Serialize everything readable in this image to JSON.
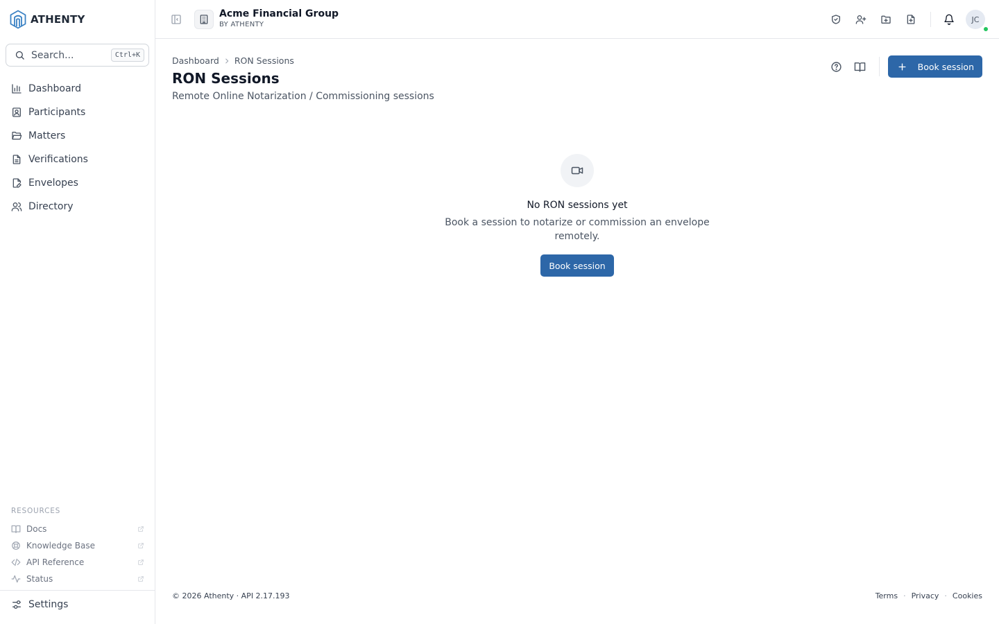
{
  "brand": {
    "name": "ATHENTY",
    "logo_icon": "athenty-logo-icon",
    "accent": "#2d67a8"
  },
  "search": {
    "placeholder": "Search...",
    "shortcut": "Ctrl+K"
  },
  "sidebar": {
    "items": [
      {
        "label": "Dashboard",
        "icon": "bar-chart-icon"
      },
      {
        "label": "Participants",
        "icon": "id-badge-icon"
      },
      {
        "label": "Matters",
        "icon": "folder-open-icon"
      },
      {
        "label": "Verifications",
        "icon": "file-text-icon"
      },
      {
        "label": "Envelopes",
        "icon": "file-signature-icon"
      },
      {
        "label": "Directory",
        "icon": "users-icon"
      }
    ],
    "resources_label": "RESOURCES",
    "resources": [
      {
        "label": "Docs",
        "icon": "book-open-icon"
      },
      {
        "label": "Knowledge Base",
        "icon": "life-buoy-icon"
      },
      {
        "label": "API Reference",
        "icon": "code-icon"
      },
      {
        "label": "Status",
        "icon": "activity-icon"
      }
    ],
    "settings_label": "Settings"
  },
  "header": {
    "org_name": "Acme Financial Group",
    "org_sub": "BY ATHENTY",
    "avatar_initials": "JC",
    "online_color": "#22c55e"
  },
  "page": {
    "breadcrumb": [
      "Dashboard",
      "RON Sessions"
    ],
    "title": "RON Sessions",
    "subtitle": "Remote Online Notarization / Commissioning sessions",
    "primary_action": "Book session"
  },
  "empty_state": {
    "title": "No RON sessions yet",
    "text": "Book a session to notarize or commission an envelope remotely.",
    "action": "Book session"
  },
  "footer": {
    "copyright": "© 2026 Athenty · API 2.17.193",
    "links": [
      "Terms",
      "Privacy",
      "Cookies"
    ],
    "separator": "·"
  }
}
